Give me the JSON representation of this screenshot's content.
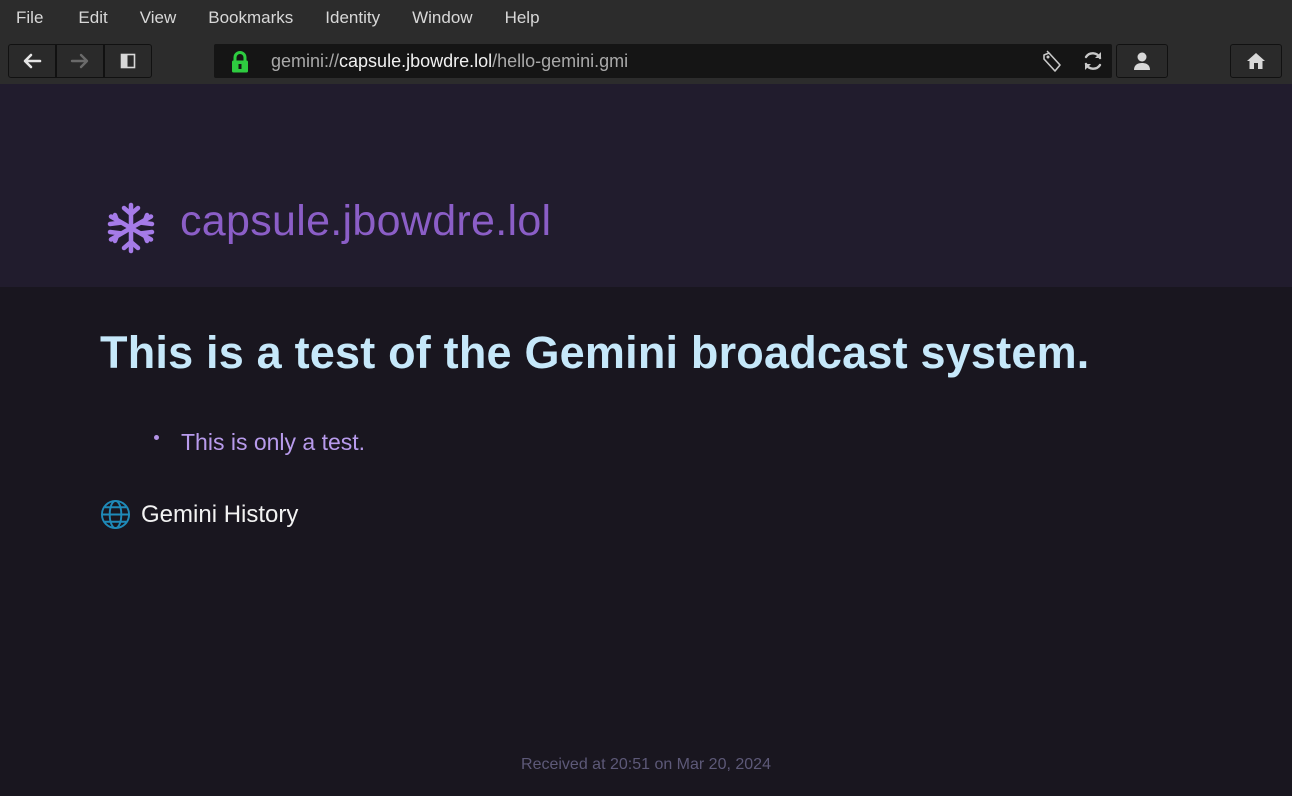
{
  "menu": [
    "File",
    "Edit",
    "View",
    "Bookmarks",
    "Identity",
    "Window",
    "Help"
  ],
  "toolbar": {
    "back_icon": "arrow-left-icon",
    "forward_icon": "arrow-right-icon",
    "sidebar_icon": "sidebar-toggle-icon",
    "identity_icon": "person-icon",
    "home_icon": "home-icon"
  },
  "url": {
    "scheme": "gemini://",
    "host": "capsule.jbowdre.lol",
    "path": "/hello-gemini.gmi"
  },
  "banner": {
    "icon": "snowflake-icon",
    "title": "capsule.jbowdre.lol"
  },
  "content": {
    "heading": "This is a test of the Gemini broadcast system.",
    "bullets": [
      "This is only a test."
    ],
    "link_text": "Gemini History"
  },
  "footer": "Received at 20:51 on Mar 20, 2024",
  "colors": {
    "accent_purple": "#8b5ec7",
    "heading_blue": "#c6e8fa",
    "lock_green": "#2ecc40"
  }
}
